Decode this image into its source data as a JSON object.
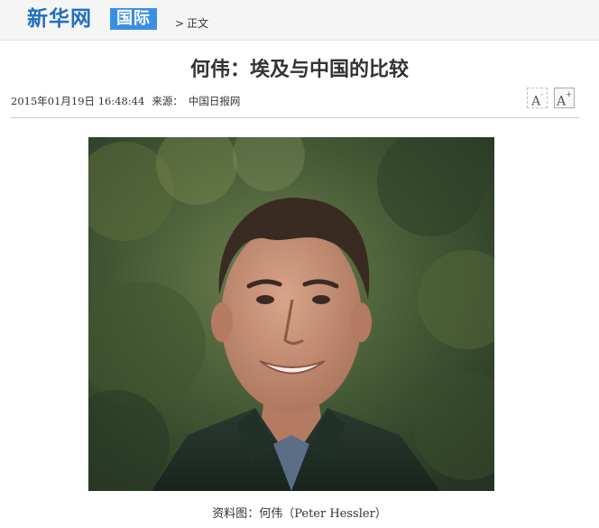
{
  "header": {
    "logo_text": "新华网",
    "channel_label": "国际",
    "breadcrumb_arrow": ">",
    "breadcrumb_label": "正文"
  },
  "article": {
    "title": "何伟：埃及与中国的比较",
    "datetime": "2015年01月19日 16:48:44",
    "source_label": "来源：",
    "source_name": "中国日报网",
    "font_smaller_label": "A",
    "font_smaller_mark": "-",
    "font_larger_label": "A",
    "font_larger_mark": "+",
    "photo_alt": "资料图：何伟（Peter Hessler）",
    "caption": "资料图：何伟（Peter Hessler）"
  },
  "colors": {
    "brand_blue": "#1f6fc0",
    "channel_blue": "#3b8ee3"
  }
}
